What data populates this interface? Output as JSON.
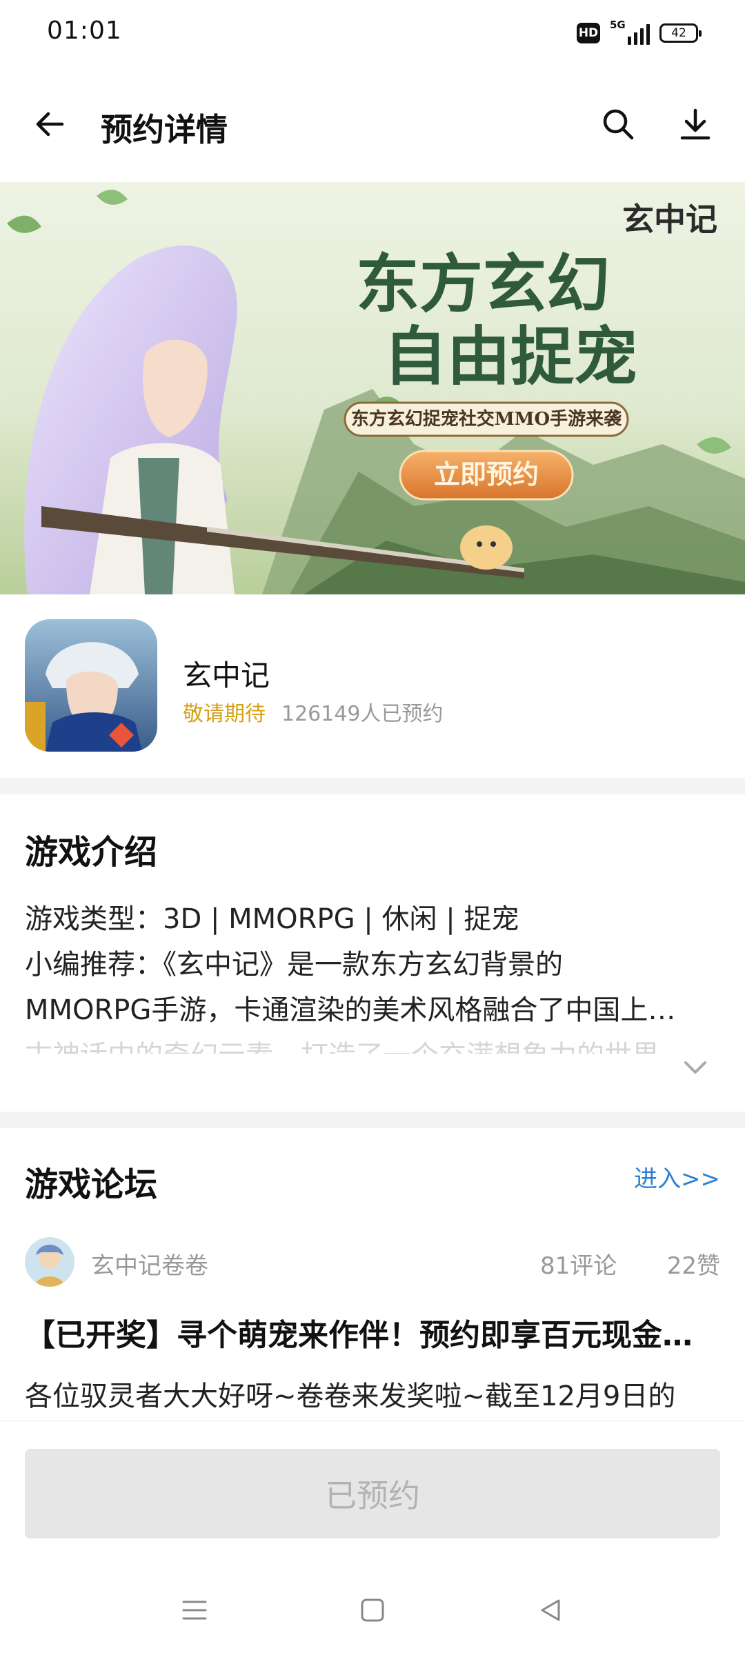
{
  "status_bar": {
    "time": "01:01",
    "hd_label": "HD",
    "network_label": "5G",
    "battery_level": "42"
  },
  "header": {
    "title": "预约详情",
    "back_icon": "arrow-left-icon",
    "search_icon": "search-icon",
    "download_icon": "download-icon"
  },
  "banner": {
    "logo_text": "玄中记",
    "headline_line1": "东方玄幻",
    "headline_line2": "自由捉宠",
    "tagline": "东方玄幻捉宠社交MMO手游来袭",
    "cta_label": "立即预约"
  },
  "app": {
    "name": "玄中记",
    "status": "敬请期待",
    "reservation_count": "126149人已预约"
  },
  "intro": {
    "title": "游戏介绍",
    "line1": "游戏类型：3D | MMORPG | 休闲 | 捉宠",
    "line2": "小编推荐：《玄中记》是一款东方玄幻背景的",
    "line3": "MMORPG手游，卡通渲染的美术风格融合了中国上…",
    "line4": "古神话中的奇幻元素，打造了一个充满想象力的世界"
  },
  "forum": {
    "title": "游戏论坛",
    "enter_link": "进入>>",
    "post": {
      "author": "玄中记卷卷",
      "comments": "81评论",
      "likes": "22赞",
      "title": "【已开奖】寻个萌宠来作伴！预约即享百元现金红包",
      "excerpt": "各位驭灵者大大好呀~卷卷来发奖啦~截至12月9日的"
    }
  },
  "bottom": {
    "reserve_button": "已预约"
  },
  "colors": {
    "accent_blue": "#2a7fd4",
    "status_gold": "#d4a017",
    "muted_gray": "#999999",
    "disabled_bg": "#e6e6e6"
  }
}
